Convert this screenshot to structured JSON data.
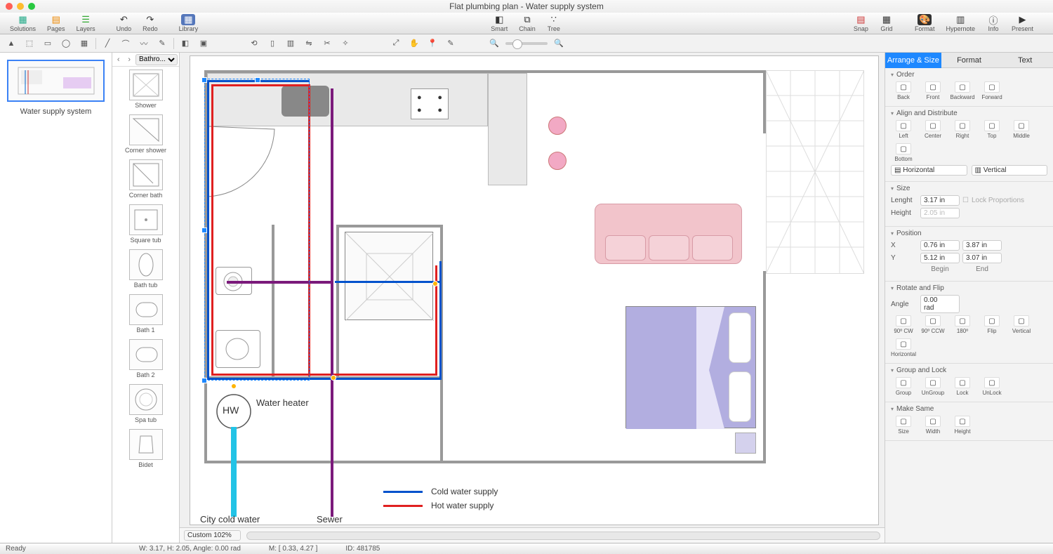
{
  "window": {
    "title": "Flat plumbing plan - Water supply system"
  },
  "main_toolbar": {
    "left": [
      {
        "label": "Solutions",
        "icon": "▦"
      },
      {
        "label": "Pages",
        "icon": "▤"
      },
      {
        "label": "Layers",
        "icon": "☰"
      }
    ],
    "undo": {
      "label": "Undo",
      "icon": "↶"
    },
    "redo": {
      "label": "Redo",
      "icon": "↷"
    },
    "library": {
      "label": "Library",
      "icon": "▦"
    },
    "center": [
      {
        "label": "Smart",
        "icon": "◧"
      },
      {
        "label": "Chain",
        "icon": "⧉"
      },
      {
        "label": "Tree",
        "icon": "∵"
      }
    ],
    "right": [
      {
        "label": "Snap",
        "icon": "▤"
      },
      {
        "label": "Grid",
        "icon": "▦"
      }
    ],
    "far_right": [
      {
        "label": "Format",
        "icon": "🎨"
      },
      {
        "label": "Hypernote",
        "icon": "▥"
      },
      {
        "label": "Info",
        "icon": "ⓘ"
      },
      {
        "label": "Present",
        "icon": "▶"
      }
    ]
  },
  "thumbs": {
    "page_name": "Water supply system"
  },
  "library": {
    "category": "Bathro...",
    "items": [
      "Shower",
      "Corner shower",
      "Corner bath",
      "Square tub",
      "Bath tub",
      "Bath 1",
      "Bath 2",
      "Spa tub",
      "Bidet"
    ]
  },
  "canvas_labels": {
    "water_heater": "Water heater",
    "hw": "HW",
    "city_cold": "City cold water",
    "sewer": "Sewer",
    "cold_supply": "Cold water supply",
    "hot_supply": "Hot water supply"
  },
  "inspector": {
    "tabs": [
      "Arrange & Size",
      "Format",
      "Text"
    ],
    "order": {
      "title": "Order",
      "btns": [
        "Back",
        "Front",
        "Backward",
        "Forward"
      ]
    },
    "align": {
      "title": "Align and Distribute",
      "btns": [
        "Left",
        "Center",
        "Right",
        "Top",
        "Middle",
        "Bottom"
      ],
      "h": "Horizontal",
      "v": "Vertical"
    },
    "size": {
      "title": "Size",
      "length_lbl": "Lenght",
      "length_val": "3.17 in",
      "height_lbl": "Height",
      "height_val": "2.05 in",
      "lock": "Lock Proportions"
    },
    "position": {
      "title": "Position",
      "x": "X",
      "y": "Y",
      "x1": "0.76 in",
      "x2": "3.87 in",
      "y1": "5.12 in",
      "y2": "3.07 in",
      "begin": "Begin",
      "end": "End"
    },
    "rotate": {
      "title": "Rotate and Flip",
      "angle_lbl": "Angle",
      "angle_val": "0.00 rad",
      "btns": [
        "90º CW",
        "90º CCW",
        "180º",
        "Flip",
        "Vertical",
        "Horizontal"
      ]
    },
    "group": {
      "title": "Group and Lock",
      "btns": [
        "Group",
        "UnGroup",
        "Lock",
        "UnLock"
      ]
    },
    "same": {
      "title": "Make Same",
      "btns": [
        "Size",
        "Width",
        "Height"
      ]
    }
  },
  "canvas_bar": {
    "zoom": "Custom 102%"
  },
  "status": {
    "ready": "Ready",
    "dims": "W: 3.17,  H: 2.05,  Angle: 0.00 rad",
    "mouse": "M: [ 0.33, 4.27 ]",
    "id": "ID: 481785"
  }
}
